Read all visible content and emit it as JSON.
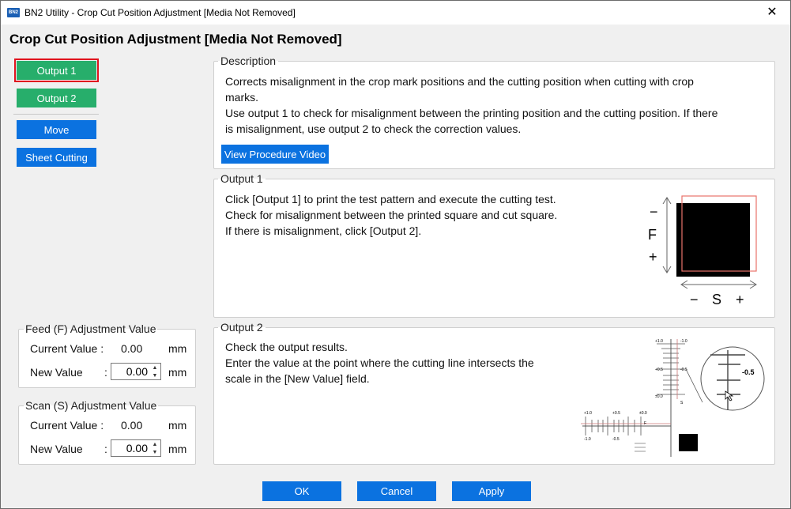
{
  "window": {
    "title": "BN2 Utility - Crop Cut Position Adjustment [Media Not Removed]",
    "app_icon_text": "BN2",
    "close_glyph": "✕"
  },
  "heading": "Crop Cut Position Adjustment [Media Not Removed]",
  "sidebar": {
    "output1_label": "Output 1",
    "output2_label": "Output 2",
    "move_label": "Move",
    "sheet_cutting_label": "Sheet Cutting",
    "selected": "Output 1"
  },
  "feed": {
    "title": "Feed (F) Adjustment Value",
    "current_label": "Current Value :",
    "current_value": "0.00",
    "unit": "mm",
    "new_label": "New Value",
    "colon": ":",
    "new_value": "0.00"
  },
  "scan": {
    "title": "Scan (S) Adjustment Value",
    "current_label": "Current Value :",
    "current_value": "0.00",
    "unit": "mm",
    "new_label": "New Value",
    "colon": ":",
    "new_value": "0.00"
  },
  "description": {
    "title": "Description",
    "line1": "Corrects misalignment in the crop mark positions and the cutting position when cutting with crop",
    "line2": "marks.",
    "line3": "Use output 1 to check for misalignment between the printing position and the cutting position. If there",
    "line4": "is misalignment, use output 2 to check the correction values.",
    "video_button": "View Procedure Video"
  },
  "output1": {
    "title": "Output 1",
    "line1": "Click [Output 1] to print the test pattern and execute the cutting test.",
    "line2": "Check for misalignment between the printed square and cut square.",
    "line3": "If there is misalignment, click [Output 2].",
    "diagram": {
      "minus": "−",
      "plus": "+",
      "f_label": "F",
      "s_label": "S"
    }
  },
  "output2": {
    "title": "Output 2",
    "line1": "Check the output results.",
    "line2": "Enter the value at the point where the cutting line intersects the",
    "line3": "scale in the [New Value] field.",
    "diagram": {
      "zoom_value": "-0.5",
      "t_p10": "+1.0",
      "t_p05": "+0.5",
      "t_00": "±0.0",
      "t_m05": "-0.5",
      "t_m10": "-1.0",
      "s_label": "S",
      "f_label": "F"
    }
  },
  "footer": {
    "ok": "OK",
    "cancel": "Cancel",
    "apply": "Apply"
  },
  "colors": {
    "green": "#27ae6b",
    "blue": "#0b72e0",
    "selection": "#e0141e",
    "cut_line": "#e8736b"
  }
}
